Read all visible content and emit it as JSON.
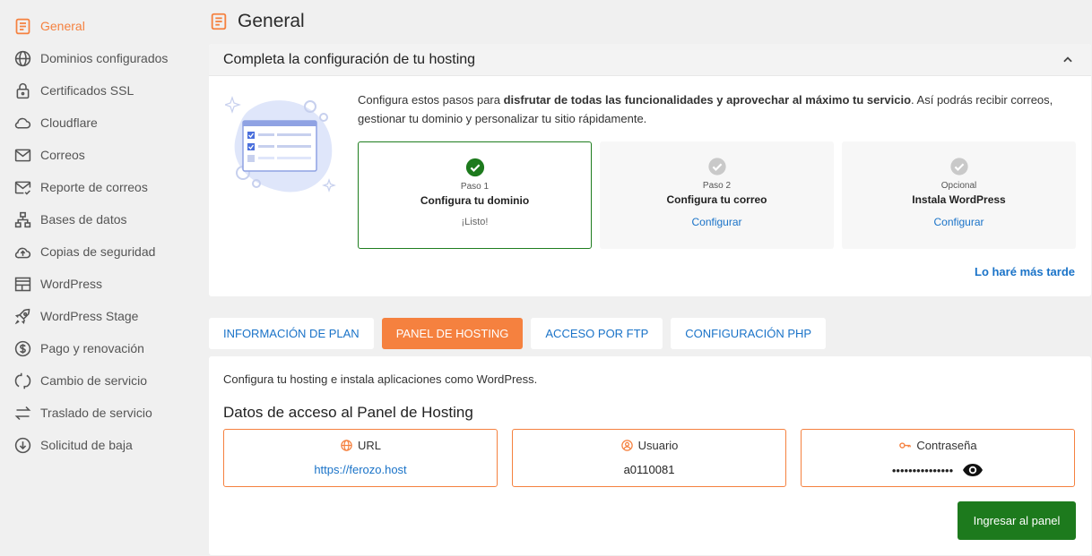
{
  "sidebar": {
    "items": [
      {
        "label": "General",
        "icon": "document-icon"
      },
      {
        "label": "Dominios configurados",
        "icon": "globe-icon"
      },
      {
        "label": "Certificados SSL",
        "icon": "lock-icon"
      },
      {
        "label": "Cloudflare",
        "icon": "cloud-icon"
      },
      {
        "label": "Correos",
        "icon": "mail-icon"
      },
      {
        "label": "Reporte de correos",
        "icon": "mail-check-icon"
      },
      {
        "label": "Bases de datos",
        "icon": "database-tree-icon"
      },
      {
        "label": "Copias de seguridad",
        "icon": "cloud-upload-icon"
      },
      {
        "label": "WordPress",
        "icon": "layout-icon"
      },
      {
        "label": "WordPress Stage",
        "icon": "rocket-icon"
      },
      {
        "label": "Pago y renovación",
        "icon": "dollar-icon"
      },
      {
        "label": "Cambio de servicio",
        "icon": "refresh-icon"
      },
      {
        "label": "Traslado de servicio",
        "icon": "swap-icon"
      },
      {
        "label": "Solicitud de baja",
        "icon": "arrow-down-circle-icon"
      }
    ]
  },
  "header": {
    "title": "General"
  },
  "setup": {
    "title": "Completa la configuración de tu hosting",
    "desc_pre": "Configura estos pasos para ",
    "desc_bold": "disfrutar de todas las funcionalidades y aprovechar al máximo tu servicio",
    "desc_post": ". Así podrás recibir correos, gestionar tu dominio y personalizar tu sitio rápidamente.",
    "steps": [
      {
        "num": "Paso 1",
        "name": "Configura tu dominio",
        "status": "¡Listo!"
      },
      {
        "num": "Paso 2",
        "name": "Configura tu correo",
        "link": "Configurar"
      },
      {
        "num": "Opcional",
        "name": "Instala WordPress",
        "link": "Configurar"
      }
    ],
    "later": "Lo haré más tarde"
  },
  "tabs": [
    "INFORMACIÓN DE PLAN",
    "PANEL DE HOSTING",
    "ACCESO POR FTP",
    "CONFIGURACIÓN PHP"
  ],
  "panel": {
    "intro": "Configura tu hosting e instala aplicaciones como WordPress.",
    "subtitle": "Datos de acceso al Panel de Hosting",
    "url_label": "URL",
    "url_value": "https://ferozo.host",
    "user_label": "Usuario",
    "user_value": "a0110081",
    "pass_label": "Contraseña",
    "pass_value": "•••••••••••••••",
    "button": "Ingresar al panel"
  },
  "colors": {
    "accent": "#f5813f",
    "link": "#1a73c8",
    "success": "#1d7a1d"
  }
}
